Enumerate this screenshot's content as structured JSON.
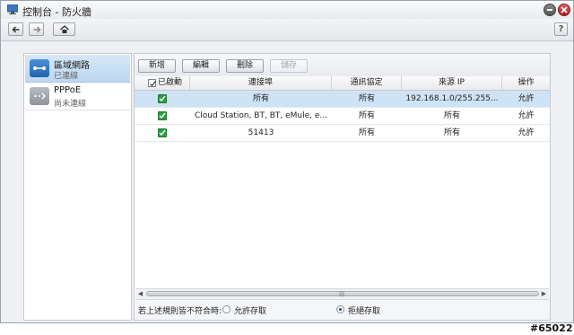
{
  "window": {
    "title": "控制台 - 防火牆",
    "help_label": "?"
  },
  "sidebar": {
    "items": [
      {
        "label": "區域網路",
        "status": "已連線"
      },
      {
        "label": "PPPoE",
        "status": "尚未連線"
      }
    ]
  },
  "actions": {
    "add": "新增",
    "edit": "編輯",
    "delete": "刪除",
    "save": "儲存"
  },
  "table": {
    "columns": [
      "已啟動",
      "連接埠",
      "通訊協定",
      "來源 IP",
      "操作"
    ],
    "rows": [
      {
        "enabled": true,
        "port": "所有",
        "protocol": "所有",
        "source_ip": "192.168.1.0/255.255...",
        "action": "允許"
      },
      {
        "enabled": true,
        "port": "Cloud Station, BT, BT, eMule, e...",
        "protocol": "所有",
        "source_ip": "所有",
        "action": "允許"
      },
      {
        "enabled": true,
        "port": "51413",
        "protocol": "所有",
        "source_ip": "所有",
        "action": "允許"
      }
    ]
  },
  "policy": {
    "label": "若上述規則皆不符合時:",
    "allow_label": "允許存取",
    "deny_label": "拒絕存取",
    "selected": "deny"
  },
  "watermark": "#65022",
  "colors": {
    "selection": "#cfe3f6",
    "accent": "#2563ab",
    "check": "#2f9e44"
  }
}
